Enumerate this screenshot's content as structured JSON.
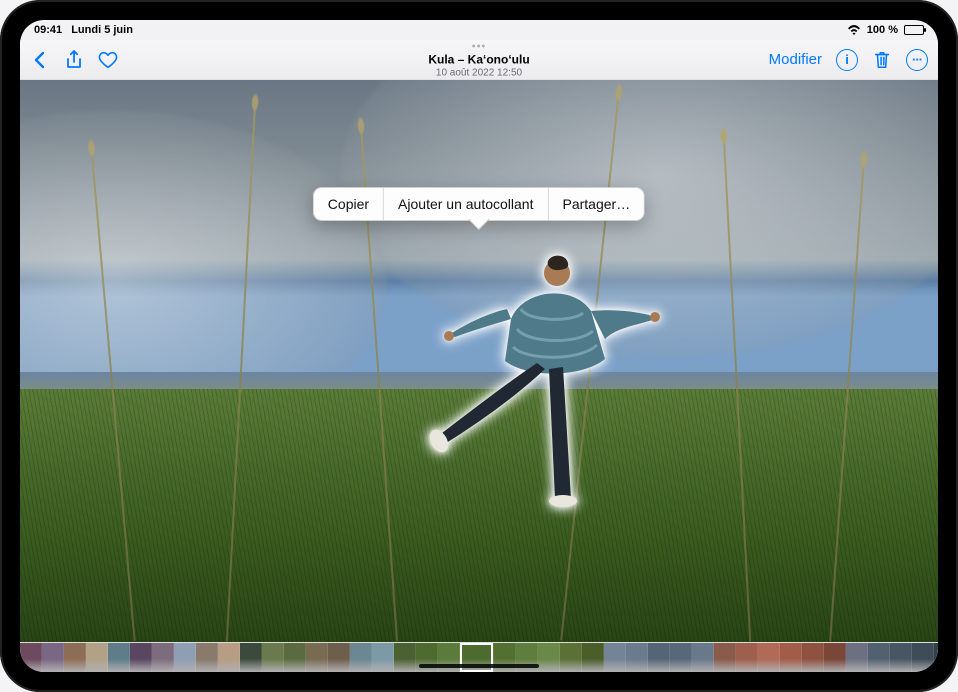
{
  "status": {
    "time": "09:41",
    "date": "Lundi 5 juin",
    "battery_pct": "100 %"
  },
  "toolbar": {
    "title": "Kula – Ka‘ono‘ulu",
    "subtitle": "10 août 2022 12:50",
    "edit_label": "Modifier"
  },
  "popover": {
    "copy": "Copier",
    "add_sticker": "Ajouter un autocollant",
    "share": "Partager…"
  },
  "background": {
    "sky_colors": [
      "#6a7784",
      "#8f9aa1",
      "#5d7fa5"
    ],
    "grass_colors": [
      "#5f7a3e",
      "#2a4417"
    ],
    "horizon_color": "#6b86a2"
  },
  "subject": {
    "shirt_color": "#4f7a8a",
    "pants_color": "#1f2833",
    "skin_color": "#a97b54",
    "glow_color": "#ffffff"
  },
  "thumbs": [
    "#6d4a5e",
    "#7a6783",
    "#8e6d56",
    "#b3a187",
    "#5f7d88",
    "#5a4660",
    "#7d6c7e",
    "#8f9eb3",
    "#8a7a6c",
    "#b69d84",
    "#3c4a3d",
    "#6a7a4c",
    "#5c6b3f",
    "#796b52",
    "#6e5e4c",
    "#6b8792",
    "#7c9aa6",
    "#4b6131",
    "#4f6a2f",
    "#5a7b3a",
    "#4e6a2d",
    "#537030",
    "#5f7d3c",
    "#6a8848",
    "#5a7035",
    "#4b5e2a",
    "#748395",
    "#6b7a8c",
    "#566575",
    "#596878",
    "#6a7989",
    "#8a5a4a",
    "#9e5f4c",
    "#b06a55",
    "#a25d49",
    "#8f5240",
    "#7a4638",
    "#6c7080",
    "#52616f",
    "#485663",
    "#3e4c58",
    "#34414c"
  ]
}
